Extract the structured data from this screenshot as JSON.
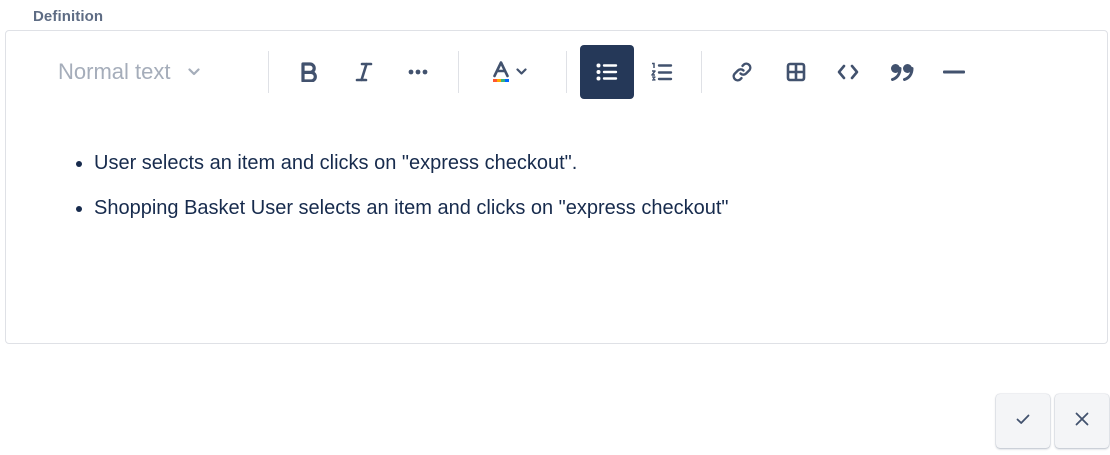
{
  "field": {
    "label": "Definition"
  },
  "toolbar": {
    "text_style": "Normal text",
    "icons": [
      "bold-icon",
      "italic-icon",
      "more-formatting-icon",
      "text-color-icon",
      "bullet-list-icon",
      "numbered-list-icon",
      "link-icon",
      "table-icon",
      "code-icon",
      "quote-icon",
      "divider-icon"
    ],
    "active_item": "bullet-list",
    "colors": {
      "active_bg": "#253858",
      "icon": "#42526e",
      "muted": "#a5adba"
    }
  },
  "content": {
    "bullets": [
      "User selects an item and clicks on \"express checkout\".",
      "Shopping Basket User selects an item and clicks on \"express checkout\""
    ]
  },
  "actions": {
    "confirm": "check-icon",
    "cancel": "close-icon"
  }
}
